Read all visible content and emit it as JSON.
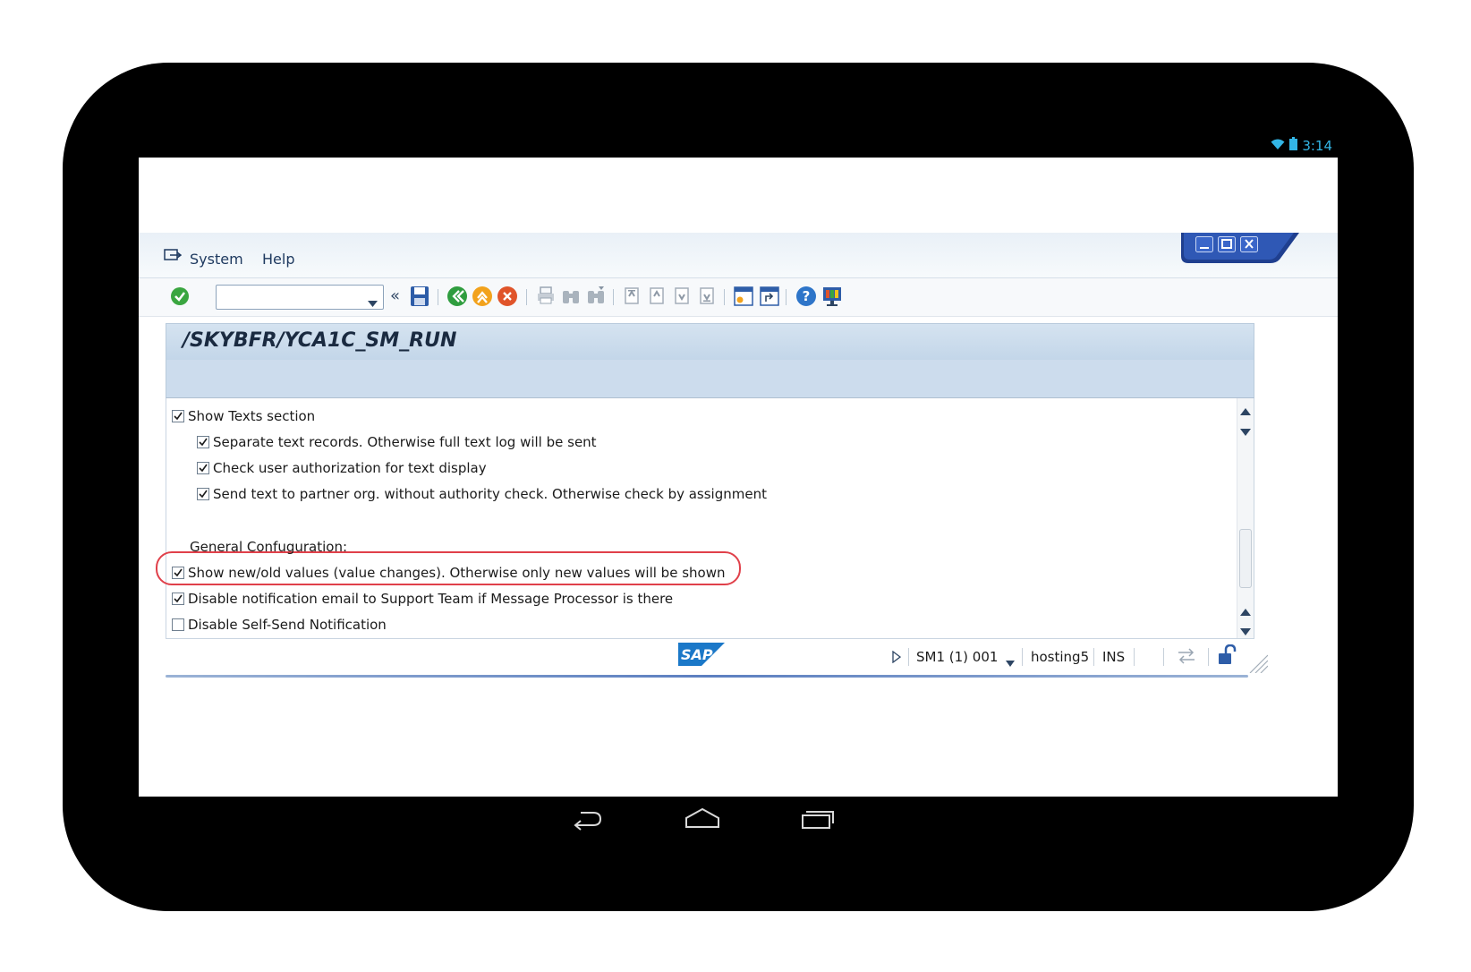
{
  "device": {
    "status_time": "3:14"
  },
  "menu": {
    "items": [
      "System",
      "Help"
    ]
  },
  "toolbar": {
    "command_field_value": ""
  },
  "screen_title": "/SKYBFR/YCA1C_SM_RUN",
  "options": {
    "rows": [
      {
        "label": "Show Texts section",
        "checked": true
      },
      {
        "label": "Separate text records. Otherwise full text log will be sent",
        "checked": true
      },
      {
        "label": "Check user authorization for text display",
        "checked": true
      },
      {
        "label": "Send text to partner org. without authority check. Otherwise check by assignment",
        "checked": true
      },
      {
        "label": "General Confuguration:"
      },
      {
        "label": "Show new/old values (value changes). Otherwise only new values will be shown",
        "checked": true
      },
      {
        "label": "Disable notification email to Support Team if Message Processor is there",
        "checked": true
      },
      {
        "label": "Disable Self-Send Notification",
        "checked": false
      }
    ]
  },
  "statusbar": {
    "logo": "SAP",
    "system": "SM1 (1) 001",
    "server": "hosting5",
    "mode": "INS"
  },
  "colors": {
    "highlight": "#e0404a",
    "android_accent": "#33b5e5",
    "title_bar": "#c3d6e9"
  }
}
